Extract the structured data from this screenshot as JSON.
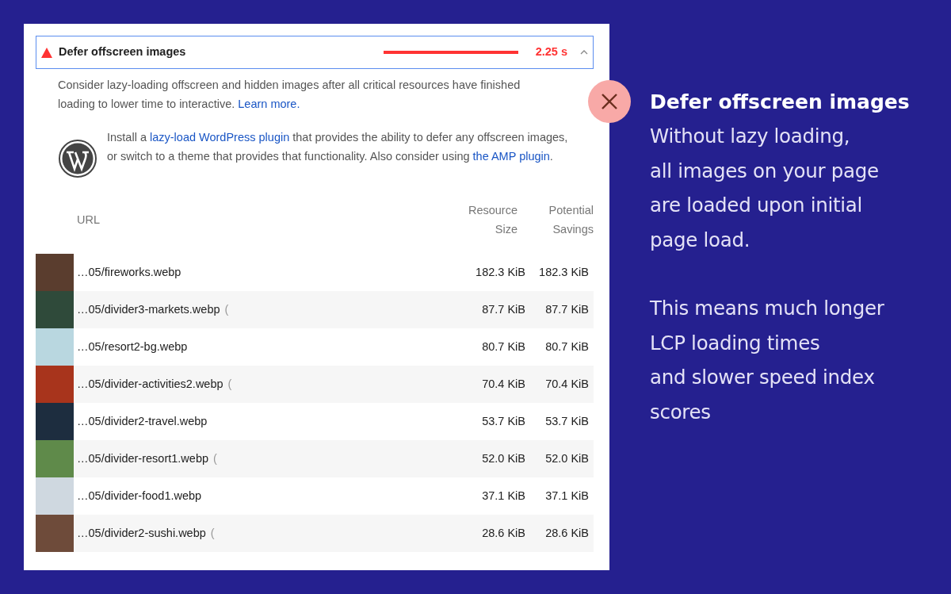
{
  "audit": {
    "title": "Defer offscreen images",
    "savings": "2.25 s",
    "expanded": true,
    "description": {
      "text": "Consider lazy-loading offscreen and hidden images after all critical resources have finished loading to lower time to interactive.",
      "link": "Learn more."
    },
    "stack_pack": {
      "before": "Install a",
      "link_1": "lazy-load WordPress plugin",
      "middle": "that provides the ability to defer any offscreen images, or switch to a theme that provides that functionality. Also consider using",
      "link_2": "the AMP plugin",
      "after": "."
    },
    "table": {
      "columns": [
        "URL",
        "Resource Size",
        "Potential Savings"
      ],
      "rows": [
        {
          "url": "…05/fireworks.webp",
          "note": "",
          "size": "182.3 KiB",
          "savings": "182.3 KiB"
        },
        {
          "url": "…05/divider3-markets.webp",
          "note": "(",
          "size": "87.7 KiB",
          "savings": "87.7 KiB"
        },
        {
          "url": "…05/resort2-bg.webp",
          "note": "",
          "size": "80.7 KiB",
          "savings": "80.7 KiB"
        },
        {
          "url": "…05/divider-activities2.webp",
          "note": "(",
          "size": "70.4 KiB",
          "savings": "70.4 KiB"
        },
        {
          "url": "…05/divider2-travel.webp",
          "note": "",
          "size": "53.7 KiB",
          "savings": "53.7 KiB"
        },
        {
          "url": "…05/divider-resort1.webp",
          "note": "(",
          "size": "52.0 KiB",
          "savings": "52.0 KiB"
        },
        {
          "url": "…05/divider-food1.webp",
          "note": "",
          "size": "37.1 KiB",
          "savings": "37.1 KiB"
        },
        {
          "url": "…05/divider2-sushi.webp",
          "note": "(",
          "size": "28.6 KiB",
          "savings": "28.6 KiB"
        }
      ]
    }
  },
  "callout": {
    "title": "Defer offscreen images",
    "paragraphs": [
      "Without lazy loading,\nall images on your page\nare loaded upon initial\npage load.",
      "This means much longer\nLCP loading times\nand slower speed index\nscores"
    ]
  }
}
